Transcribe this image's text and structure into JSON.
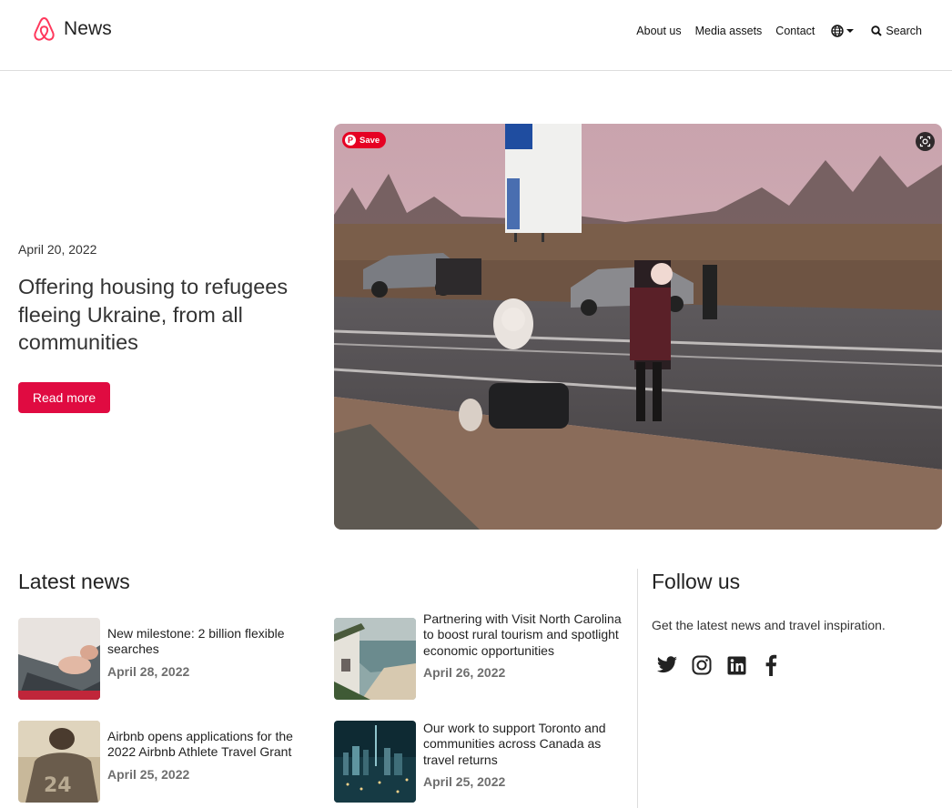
{
  "header": {
    "brand": "News",
    "nav": [
      "About us",
      "Media assets",
      "Contact"
    ],
    "language_icon": "globe-icon",
    "search_label": "Search"
  },
  "hero": {
    "date": "April 20, 2022",
    "title": "Offering housing to refugees fleeing Ukraine, from all communities",
    "button": "Read more",
    "save_label": "Save"
  },
  "latest": {
    "title": "Latest news",
    "items": [
      {
        "title": "New milestone: 2 billion flexible searches",
        "date": "April 28, 2022"
      },
      {
        "title": "Partnering with Visit North Carolina to boost rural tourism and spotlight economic opportunities",
        "date": "April 26, 2022"
      },
      {
        "title": "Airbnb opens applications for the 2022 Airbnb Athlete Travel Grant",
        "date": "April 25, 2022"
      },
      {
        "title": "Our work to support Toronto and communities across Canada as travel returns",
        "date": "April 25, 2022"
      }
    ]
  },
  "follow": {
    "title": "Follow us",
    "text": "Get the latest news and travel inspiration.",
    "socials": [
      "twitter-icon",
      "instagram-icon",
      "linkedin-icon",
      "facebook-icon"
    ]
  },
  "colors": {
    "accent": "#e00b41",
    "pinterest": "#e60023"
  }
}
